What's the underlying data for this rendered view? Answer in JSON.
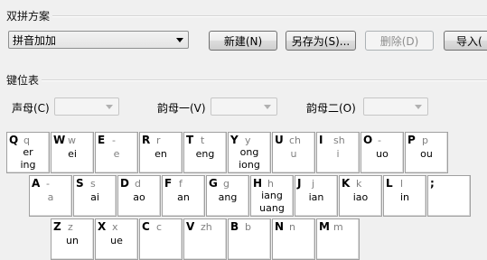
{
  "scheme": {
    "title": "双拼方案",
    "selected": "拼音加加",
    "buttons": {
      "new": "新建(N)",
      "save_as": "另存为(S)...",
      "delete": "删除(D)",
      "import": "导入("
    }
  },
  "keymap": {
    "title": "键位表",
    "initial_label": "声母(C)",
    "final1_label": "韵母一(V)",
    "final2_label": "韵母二(O)"
  },
  "keyboard": {
    "row1": [
      {
        "key": "Q",
        "shengmu": "q",
        "yunmu": [
          "er",
          "ing"
        ]
      },
      {
        "key": "W",
        "shengmu": "w",
        "yunmu": [
          "ei"
        ]
      },
      {
        "key": "E",
        "shengmu": "-",
        "yunmu": [
          "e"
        ]
      },
      {
        "key": "R",
        "shengmu": "r",
        "yunmu": [
          "en"
        ]
      },
      {
        "key": "T",
        "shengmu": "t",
        "yunmu": [
          "eng"
        ]
      },
      {
        "key": "Y",
        "shengmu": "y",
        "yunmu": [
          "ong",
          "iong"
        ]
      },
      {
        "key": "U",
        "shengmu": "ch",
        "yunmu": [
          "u"
        ]
      },
      {
        "key": "I",
        "shengmu": "sh",
        "yunmu": [
          "i"
        ]
      },
      {
        "key": "O",
        "shengmu": "-",
        "yunmu": [
          "uo"
        ]
      },
      {
        "key": "P",
        "shengmu": "p",
        "yunmu": [
          "ou"
        ]
      }
    ],
    "row2": [
      {
        "key": "A",
        "shengmu": "-",
        "yunmu": [
          "a"
        ]
      },
      {
        "key": "S",
        "shengmu": "s",
        "yunmu": [
          "ai"
        ]
      },
      {
        "key": "D",
        "shengmu": "d",
        "yunmu": [
          "ao"
        ]
      },
      {
        "key": "F",
        "shengmu": "f",
        "yunmu": [
          "an"
        ]
      },
      {
        "key": "G",
        "shengmu": "g",
        "yunmu": [
          "ang"
        ]
      },
      {
        "key": "H",
        "shengmu": "h",
        "yunmu": [
          "iang",
          "uang"
        ]
      },
      {
        "key": "J",
        "shengmu": "j",
        "yunmu": [
          "ian"
        ]
      },
      {
        "key": "K",
        "shengmu": "k",
        "yunmu": [
          "iao"
        ]
      },
      {
        "key": "L",
        "shengmu": "l",
        "yunmu": [
          "in"
        ]
      },
      {
        "key": ";",
        "shengmu": "",
        "yunmu": []
      }
    ],
    "row3": [
      {
        "key": "Z",
        "shengmu": "z",
        "yunmu": [
          "un"
        ]
      },
      {
        "key": "X",
        "shengmu": "x",
        "yunmu": [
          "ue"
        ]
      },
      {
        "key": "C",
        "shengmu": "c",
        "yunmu": []
      },
      {
        "key": "V",
        "shengmu": "zh",
        "yunmu": []
      },
      {
        "key": "B",
        "shengmu": "b",
        "yunmu": []
      },
      {
        "key": "N",
        "shengmu": "n",
        "yunmu": []
      },
      {
        "key": "M",
        "shengmu": "m",
        "yunmu": []
      }
    ]
  }
}
